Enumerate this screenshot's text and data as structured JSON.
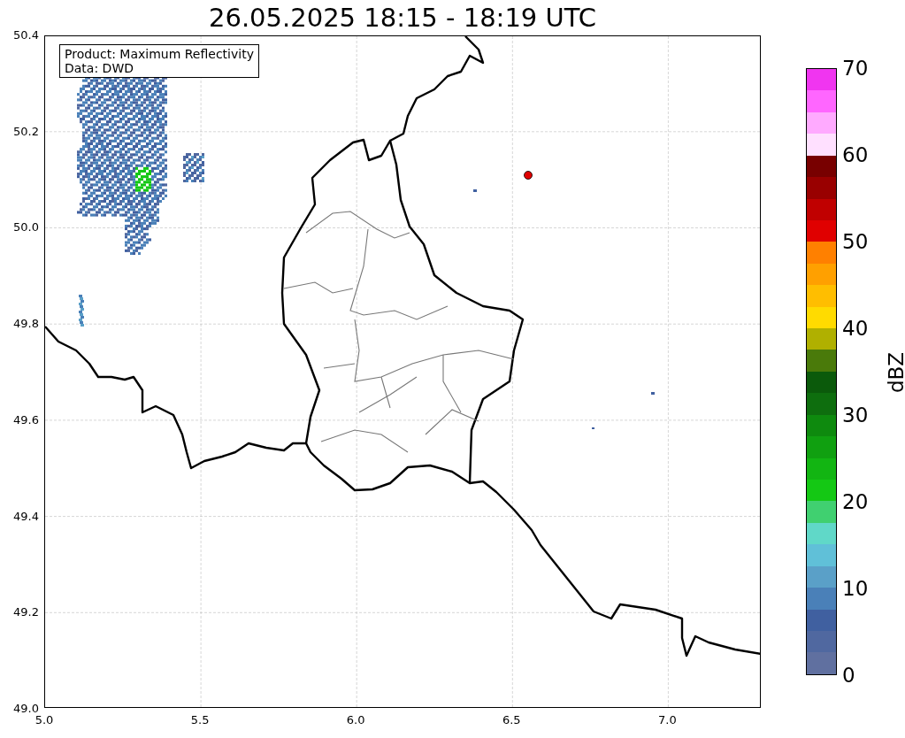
{
  "title": "26.05.2025 18:15 - 18:19 UTC",
  "info_box": [
    "Product: Maximum Reflectivity",
    "Data: DWD"
  ],
  "x_ticks": [
    "5.0",
    "5.5",
    "6.0",
    "6.5",
    "7.0"
  ],
  "y_ticks": [
    "50.4",
    "50.2",
    "50.0",
    "49.8",
    "49.6",
    "49.4",
    "49.2",
    "49.0"
  ],
  "colorbar": {
    "label": "dBZ",
    "ticks": [
      "70",
      "60",
      "50",
      "40",
      "30",
      "20",
      "10",
      "0"
    ],
    "segments": [
      {
        "color": "#f035f0"
      },
      {
        "color": "#ff66ff"
      },
      {
        "color": "#ffaaff"
      },
      {
        "color": "#ffe0ff"
      },
      {
        "color": "#780000"
      },
      {
        "color": "#990000"
      },
      {
        "color": "#c00000"
      },
      {
        "color": "#e00000"
      },
      {
        "color": "#ff8000"
      },
      {
        "color": "#ffa000"
      },
      {
        "color": "#ffbe00"
      },
      {
        "color": "#ffdb00"
      },
      {
        "color": "#b0b000"
      },
      {
        "color": "#4a7a0a"
      },
      {
        "color": "#0b5a0b"
      },
      {
        "color": "#0e6e0e"
      },
      {
        "color": "#0e8a0e"
      },
      {
        "color": "#10a010"
      },
      {
        "color": "#12b512"
      },
      {
        "color": "#14c814"
      },
      {
        "color": "#40d070"
      },
      {
        "color": "#60d8c8"
      },
      {
        "color": "#60c0d8"
      },
      {
        "color": "#5aa0c8"
      },
      {
        "color": "#4a80b8"
      },
      {
        "color": "#4060a0"
      },
      {
        "color": "#5068a0"
      },
      {
        "color": "#6070a0"
      }
    ]
  }
}
